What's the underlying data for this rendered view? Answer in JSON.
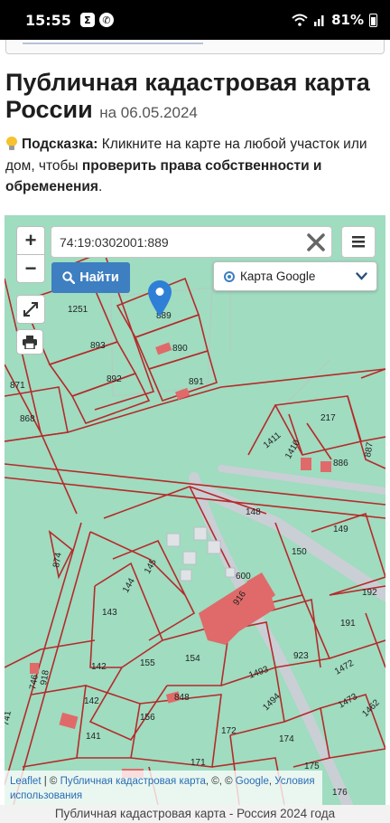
{
  "status_bar": {
    "time": "15:55",
    "notifications": [
      {
        "icon": "sigma-app-icon",
        "glyph": "Σ"
      },
      {
        "icon": "whatsapp-icon",
        "glyph": "✆"
      }
    ],
    "battery": "81%"
  },
  "page": {
    "title": "Публичная кадастровая карта России",
    "date_prefix": "на",
    "date": "06.05.2024"
  },
  "hint": {
    "label": "Подсказка:",
    "text_part1": "Кликните на карте на любой участок или дом, чтобы",
    "emphasis": "проверить права собственности и обременения",
    "text_end": "."
  },
  "map": {
    "search_value": "74:19:0302001:889",
    "find_label": "Найти",
    "zoom_in": "+",
    "zoom_out": "−",
    "layer_selected": "Карта Google",
    "parcel_labels": [
      "1251",
      "889",
      "893",
      "890",
      "892",
      "891",
      "871",
      "868",
      "217",
      "1411",
      "1410",
      "886",
      "887",
      "148",
      "149",
      "874",
      "145",
      "150",
      "600",
      "144",
      "916",
      "192",
      "143",
      "191",
      "154",
      "923",
      "142",
      "155",
      "1493",
      "1472",
      "746",
      "918",
      "848",
      "1473",
      "142",
      "156",
      "1494",
      "1462",
      "741",
      "141",
      "172",
      "174",
      "171",
      "175",
      "176"
    ],
    "colors": {
      "land": "#9fdcc0",
      "boundary": "#b52a2a",
      "road": "#c9cfd4",
      "building": "#e06a6a",
      "accent": "#3d7fc1"
    }
  },
  "attribution": {
    "leaflet": "Leaflet",
    "sep1": " | © ",
    "source": "Публичная кадастровая карта",
    "sep2": ", ©, © ",
    "google": "Google",
    "sep3": ", ",
    "terms": "Условия использования"
  },
  "footer": "Публичная кадастровая карта - Россия 2024 года"
}
